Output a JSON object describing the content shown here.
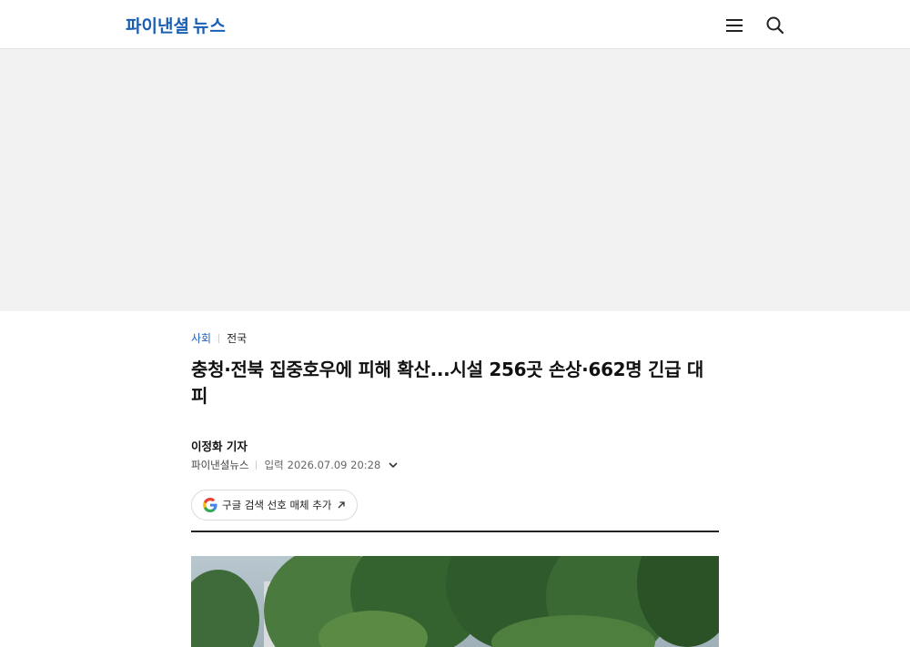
{
  "header": {
    "logo_main": "파이낸셜",
    "logo_sub": "뉴스",
    "menu_icon": "hamburger-menu-icon",
    "search_icon": "search-icon"
  },
  "article": {
    "breadcrumbs": [
      "사회",
      "전국"
    ],
    "title": "충청·전북 집중호우에 피해 확산...시설 256곳 손상·662명 긴급 대피",
    "byline": "이정화 기자",
    "outlet": "파이낸셜뉴스",
    "date_label": "입력",
    "date_value": "2026.07.09 20:28",
    "google_button_label": "구글 검색 선호 매체 추가"
  },
  "colors": {
    "brand": "#1a5fb4",
    "crumb_active": "#1f5fc4",
    "ad_background": "#f2f2f2"
  }
}
